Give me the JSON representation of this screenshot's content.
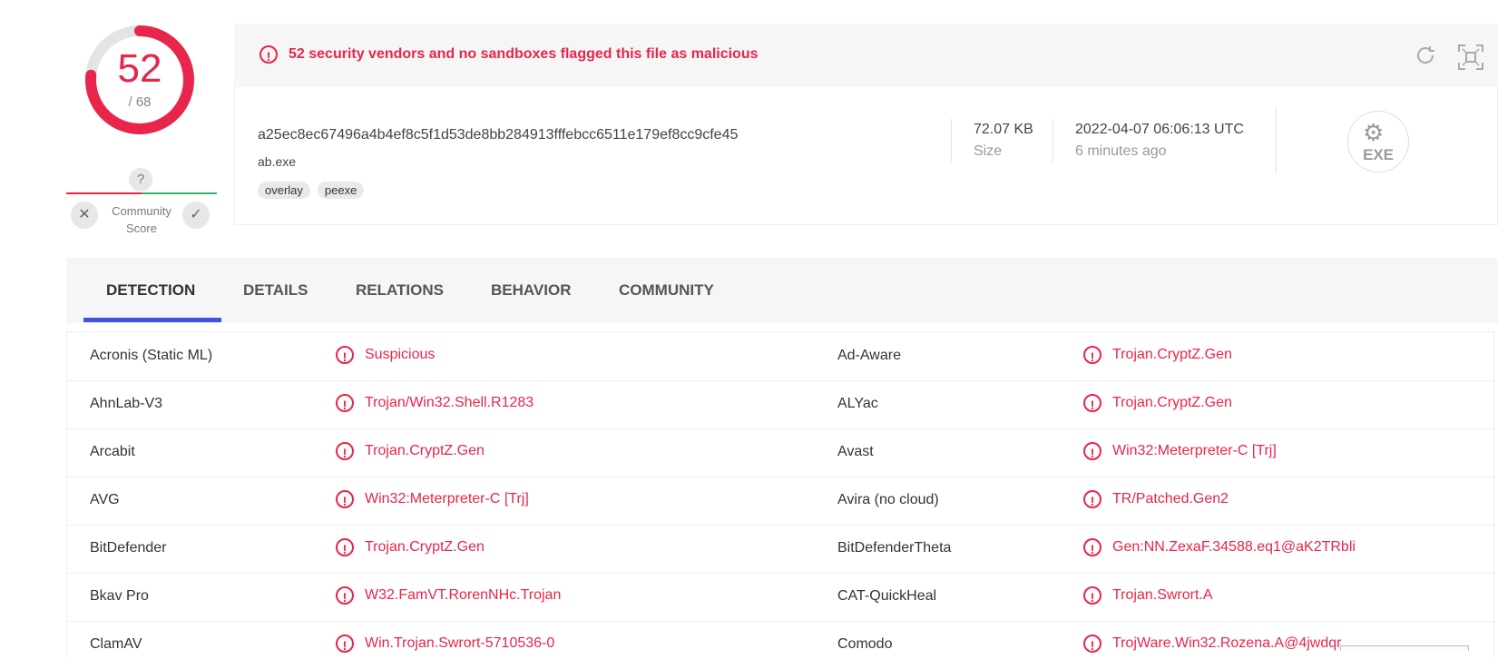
{
  "score": {
    "detections": "52",
    "total": "/ 68",
    "ratio": 0.765,
    "accent": "#e8254a",
    "community_unknown": "?",
    "community_label_1": "Community",
    "community_label_2": "Score",
    "vote_down": "✕",
    "vote_up": "✓"
  },
  "banner": {
    "message": "52 security vendors and no sandboxes flagged this file as malicious",
    "alert_icon": "!",
    "icons": [
      "refresh-icon",
      "qr-scan-icon"
    ]
  },
  "file": {
    "hash": "a25ec8ec67496a4b4ef8c5f1d53de8bb284913fffebcc6511e179ef8cc9cfe45",
    "name": "ab.exe",
    "tags": [
      "overlay",
      "peexe"
    ],
    "size_value": "72.07 KB",
    "size_label": "Size",
    "date_value": "2022-04-07 06:06:13 UTC",
    "date_label": "6 minutes ago",
    "type_label": "EXE"
  },
  "tabs": [
    "DETECTION",
    "DETAILS",
    "RELATIONS",
    "BEHAVIOR",
    "COMMUNITY"
  ],
  "detections": [
    {
      "v1": "Acronis (Static ML)",
      "r1": "Suspicious",
      "v2": "Ad-Aware",
      "r2": "Trojan.CryptZ.Gen"
    },
    {
      "v1": "AhnLab-V3",
      "r1": "Trojan/Win32.Shell.R1283",
      "v2": "ALYac",
      "r2": "Trojan.CryptZ.Gen"
    },
    {
      "v1": "Arcabit",
      "r1": "Trojan.CryptZ.Gen",
      "v2": "Avast",
      "r2": "Win32:Meterpreter-C [Trj]"
    },
    {
      "v1": "AVG",
      "r1": "Win32:Meterpreter-C [Trj]",
      "v2": "Avira (no cloud)",
      "r2": "TR/Patched.Gen2"
    },
    {
      "v1": "BitDefender",
      "r1": "Trojan.CryptZ.Gen",
      "v2": "BitDefenderTheta",
      "r2": "Gen:NN.ZexaF.34588.eq1@aK2TRbli"
    },
    {
      "v1": "Bkav Pro",
      "r1": "W32.FamVT.RorenNHc.Trojan",
      "v2": "CAT-QuickHeal",
      "r2": "Trojan.Swrort.A"
    },
    {
      "v1": "ClamAV",
      "r1": "Win.Trojan.Swrort-5710536-0",
      "v2": "Comodo",
      "r2": "TrojWare.Win32.Rozena.A@4jwdqr"
    }
  ]
}
